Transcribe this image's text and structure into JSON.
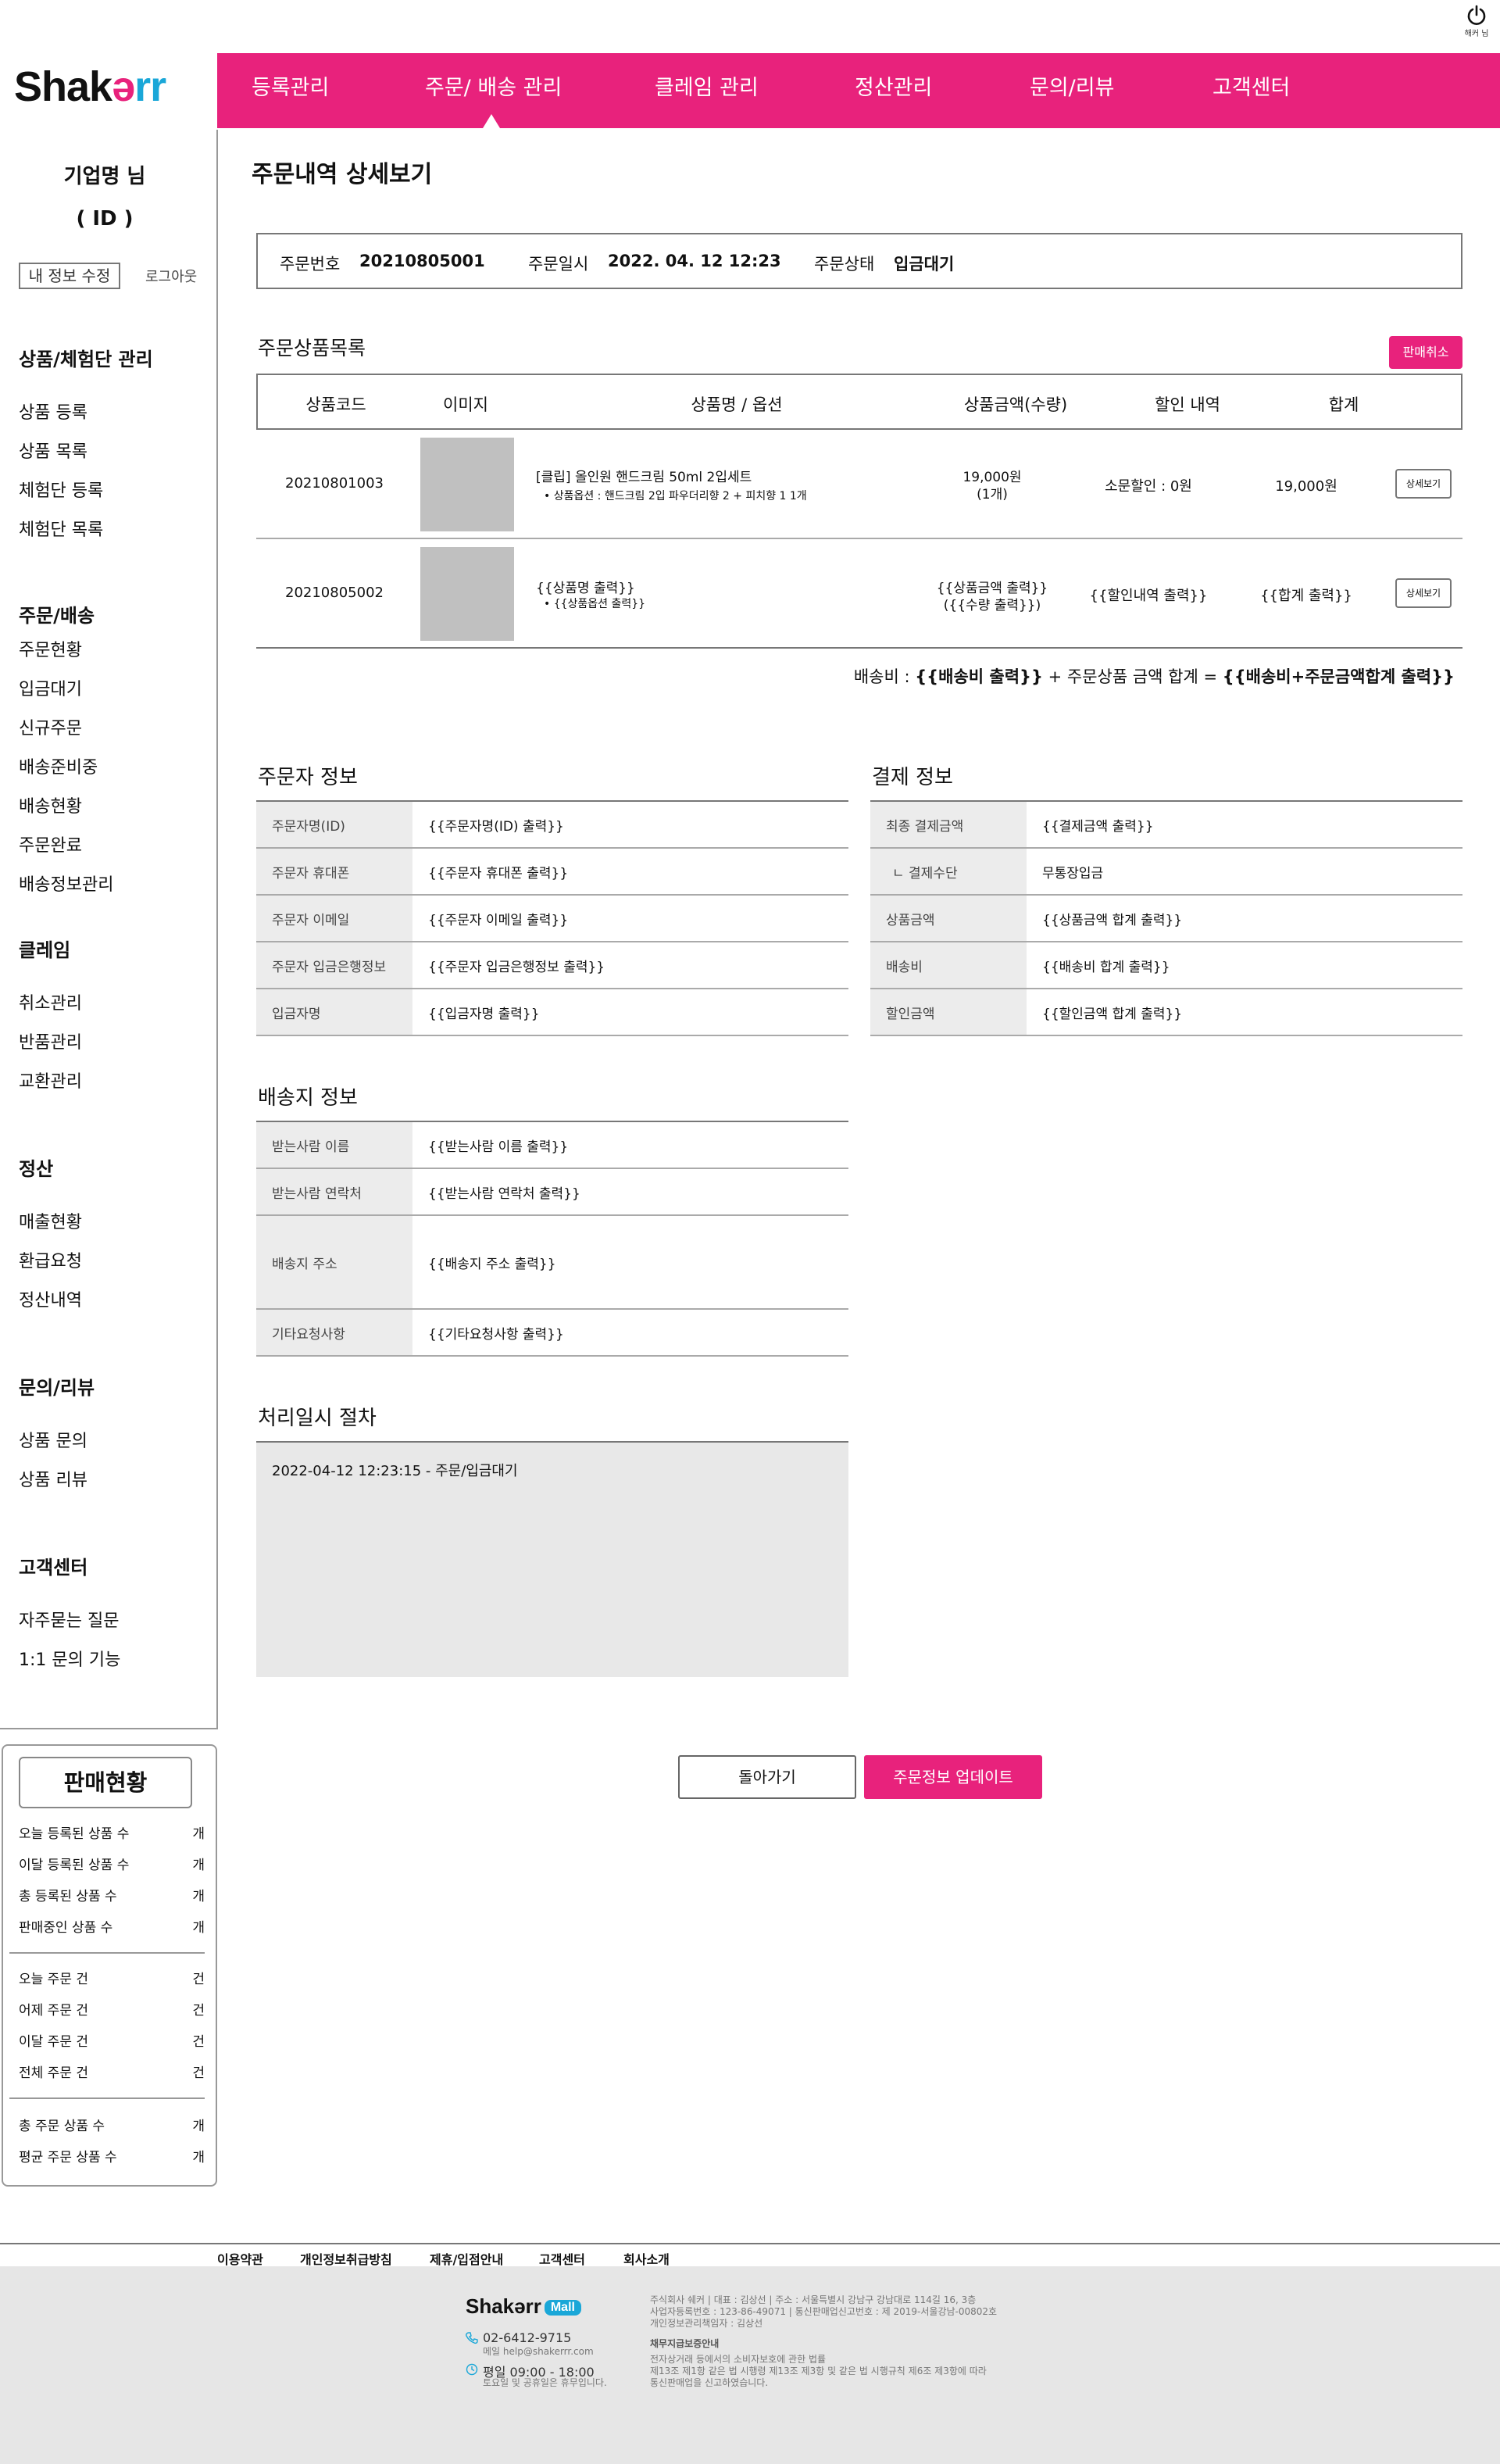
{
  "header": {
    "logout_label": "해커 님",
    "logo_parts": [
      "Shak",
      "ə",
      "rr"
    ],
    "nav": [
      "등록관리",
      "주문/ 배송 관리",
      "클레임 관리",
      "정산관리",
      "문의/리뷰",
      "고객센터"
    ]
  },
  "user": {
    "name": "기업명   님",
    "id": "( ID )",
    "edit_label": "내 정보 수정",
    "logout_link": "로그아웃"
  },
  "sidebar": {
    "sections": [
      {
        "title": "상품/체험단 관리",
        "items": [
          "상품 등록",
          "상품 목록",
          "체험단 등록",
          "체험단 목록"
        ]
      },
      {
        "title": "주문/배송",
        "items": [
          "주문현황",
          "입금대기",
          "신규주문",
          "배송준비중",
          "배송현황",
          "주문완료",
          "배송정보관리"
        ]
      },
      {
        "title": "클레임",
        "items": [
          "취소관리",
          "반품관리",
          "교환관리"
        ]
      },
      {
        "title": "정산",
        "items": [
          "매출현황",
          "환급요청",
          "정산내역"
        ]
      },
      {
        "title": "문의/리뷰",
        "items": [
          "상품 문의",
          "상품 리뷰"
        ]
      },
      {
        "title": "고객센터",
        "items": [
          "자주묻는 질문",
          "1:1 문의 기능"
        ]
      }
    ]
  },
  "sales": {
    "title": "판매현황",
    "group1": [
      {
        "label": "오늘 등록된 상품 수",
        "unit": "개"
      },
      {
        "label": "이달 등록된 상품 수",
        "unit": "개"
      },
      {
        "label": "총 등록된 상품 수",
        "unit": "개"
      },
      {
        "label": "판매중인 상품 수",
        "unit": "개"
      }
    ],
    "group2": [
      {
        "label": "오늘 주문 건",
        "unit": "건"
      },
      {
        "label": "어제 주문 건",
        "unit": "건"
      },
      {
        "label": "이달 주문 건",
        "unit": "건"
      },
      {
        "label": "전체 주문 건",
        "unit": "건"
      }
    ],
    "group3": [
      {
        "label": "총 주문 상품 수",
        "unit": "개"
      },
      {
        "label": "평균 주문 상품 수",
        "unit": "개"
      }
    ]
  },
  "page": {
    "title": "주문내역 상세보기",
    "order_no_label": "주문번호",
    "order_no": "20210805001",
    "order_date_label": "주문일시",
    "order_date": "2022. 04. 12 12:23",
    "order_status_label": "주문상태",
    "order_status": "입금대기"
  },
  "items": {
    "title": "주문상품목록",
    "cancel_label": "판매취소",
    "headers": [
      "상품코드",
      "이미지",
      "상품명 / 옵션",
      "상품금액(수량)",
      "할인 내역",
      "합계"
    ],
    "rows": [
      {
        "code": "20210801003",
        "name": "[클립] 올인원 핸드크림 50ml 2입세트",
        "option": "•  상품옵션 : 핸드크림 2입 파우더리향 2 + 피치향 1 1개",
        "price": "19,000원",
        "qty": "(1개)",
        "discount": "소문할인 : 0원",
        "total": "19,000원",
        "detail": "상세보기"
      },
      {
        "code": "20210805002",
        "name": "{{상품명 출력}}",
        "option": "•  {{상품옵션 출력}}",
        "price": "{{상품금액 출력}}",
        "qty": "({{수량 출력}})",
        "discount": "{{할인내역 출력}}",
        "total": "{{합계 출력}}",
        "detail": "상세보기"
      }
    ],
    "shipping_prefix": "배송비 : ",
    "shipping_var": "{{배송비 출력}}",
    "shipping_mid": " + 주문상품 금액 합계 = ",
    "shipping_total": "{{배송비+주문금액합계 출력}}"
  },
  "orderer": {
    "title": "주문자 정보",
    "rows": [
      {
        "label": "주문자명(ID)",
        "value": "{{주문자명(ID) 출력}}"
      },
      {
        "label": "주문자 휴대폰",
        "value": "{{주문자 휴대폰 출력}}"
      },
      {
        "label": "주문자 이메일",
        "value": "{{주문자 이메일 출력}}"
      },
      {
        "label": "주문자 입금은행정보",
        "value": "{{주문자 입금은행정보 출력}}"
      },
      {
        "label": "입금자명",
        "value": "{{입금자명 출력}}"
      }
    ]
  },
  "payment": {
    "title": "결제 정보",
    "rows": [
      {
        "label": "최종 결제금액",
        "value": "{{결제금액 출력}}"
      },
      {
        "label": "ㄴ 결제수단",
        "value": "무통장입금"
      },
      {
        "label": "상품금액",
        "value": "{{상품금액 합계 출력}}"
      },
      {
        "label": "배송비",
        "value": "{{배송비 합계 출력}}"
      },
      {
        "label": "할인금액",
        "value": "{{할인금액 합계 출력}}"
      }
    ]
  },
  "delivery": {
    "title": "배송지 정보",
    "rows": [
      {
        "label": "받는사람 이름",
        "value": "{{받는사람 이름 출력}}"
      },
      {
        "label": "받는사람 연락처",
        "value": "{{받는사람 연락처 출력}}"
      },
      {
        "label": "배송지 주소",
        "value": "{{배송지 주소 출력}}"
      },
      {
        "label": "기타요청사항",
        "value": "{{기타요청사항 출력}}"
      }
    ]
  },
  "process": {
    "title": "처리일시 절차",
    "entry": "2022-04-12 12:23:15 - 주문/입금대기"
  },
  "actions": {
    "back": "돌아가기",
    "update": "주문정보 업데이트"
  },
  "footer": {
    "links": [
      "이용약관",
      "개인정보취급방침",
      "제휴/입점안내",
      "고객센터",
      "회사소개"
    ],
    "logo_text": "Shakərr",
    "logo_badge": "Mall",
    "phone": "02-6412-9715",
    "email": "메일 help@shakerrr.com",
    "hours": "평일 09:00 - 18:00",
    "hours_note": "토요일 및 공휴일은 휴무입니다.",
    "company_lines": [
      "주식회사 쉐커 | 대표 : 김상선 | 주소 : 서울특별시 강남구 강남대로 114길 16, 3층",
      "사업자등록번호 : 123-86-49071 | 통신판매업신고번호 : 제 2019-서울강남-00802호",
      "개인정보관리책임자 : 김상선"
    ],
    "notice_title": "채무지급보증안내",
    "notice_lines": [
      "전자상거래 등에서의 소비자보호에 관한 법률",
      "제13조 제1항 같은 법 시행령 제13조 제3항 및 같은 법 시행규칙 제6조 제3항에 따라",
      "통신판매업을 신고하였습니다."
    ],
    "colors": {
      "accent": "#e8227c",
      "cyan": "#1aa7d8"
    }
  }
}
